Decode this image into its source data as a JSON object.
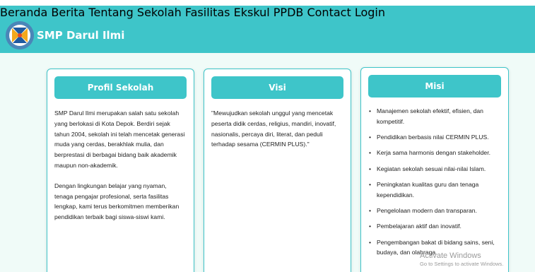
{
  "brand": {
    "title": "SMP Darul Ilmi"
  },
  "nav": {
    "items": [
      "Beranda",
      "Berita",
      "Tentang Sekolah",
      "Fasilitas",
      "Ekskul",
      "PPDB",
      "Contact",
      "Login"
    ]
  },
  "cards": {
    "profil": {
      "title": "Profil Sekolah",
      "paragraphs": [
        "SMP Darul Ilmi merupakan salah satu sekolah yang berlokasi di Kota Depok. Berdiri sejak tahun 2004, sekolah ini telah mencetak generasi muda yang cerdas, berakhlak mulia, dan berprestasi di berbagai bidang baik akademik maupun non-akademik.",
        "Dengan lingkungan belajar yang nyaman, tenaga pengajar profesional, serta fasilitas lengkap, kami terus berkomitmen memberikan pendidikan terbaik bagi siswa-siswi kami."
      ]
    },
    "visi": {
      "title": "Visi",
      "text": "\"Mewujudkan sekolah unggul yang mencetak peserta didik cerdas, religius, mandiri, inovatif, nasionalis, percaya diri, literat, dan peduli terhadap sesama (CERMIN PLUS).\""
    },
    "misi": {
      "title": "Misi",
      "items": [
        "Manajemen sekolah efektif, efisien, dan kompetitif.",
        "Pendidikan berbasis nilai CERMIN PLUS.",
        "Kerja sama harmonis dengan stakeholder.",
        "Kegiatan sekolah sesuai nilai-nilai Islam.",
        "Peningkatan kualitas guru dan tenaga kependidikan.",
        "Pengelolaan modern dan transparan.",
        "Pembelajaran aktif dan inovatif.",
        "Pengembangan bakat di bidang sains, seni, budaya, dan olahraga."
      ]
    }
  },
  "watermark": {
    "line1": "Activate Windows",
    "line2": "Go to Settings to activate Windows."
  },
  "colors": {
    "accent": "#3ec5c9",
    "background": "#f0fbf8"
  }
}
